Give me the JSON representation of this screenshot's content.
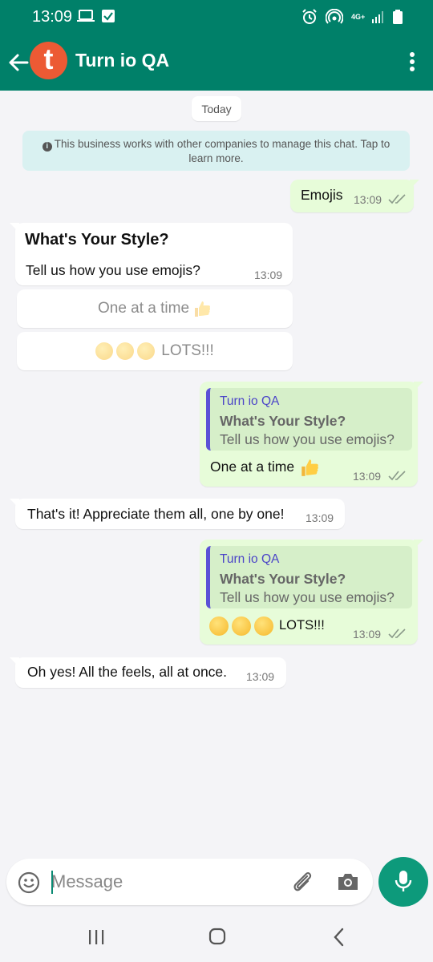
{
  "status_bar": {
    "time": "13:09",
    "network": "4G+"
  },
  "header": {
    "contact_name": "Turn io QA",
    "avatar_letter": "t",
    "avatar_color": "#ec5a34",
    "bar_color": "#008069"
  },
  "chat": {
    "day_chip": "Today",
    "notice": "This business works with other companies to manage this chat. Tap to learn more.",
    "messages": [
      {
        "direction": "out",
        "text": "Emojis",
        "time": "13:09"
      },
      {
        "direction": "in",
        "title": "What's Your Style?",
        "text": "Tell us how you use emojis?",
        "time": "13:09",
        "quick_replies": [
          "One at a time",
          "LOTS!!!"
        ]
      },
      {
        "direction": "out",
        "quote": {
          "author": "Turn io QA",
          "title": "What's Your Style?",
          "body": "Tell us how you use emojis?"
        },
        "text": "One at a time",
        "time": "13:09"
      },
      {
        "direction": "in",
        "text": "That's it! Appreciate them all, one by one!",
        "time": "13:09"
      },
      {
        "direction": "out",
        "quote": {
          "author": "Turn io QA",
          "title": "What's Your Style?",
          "body": "Tell us how you use emojis?"
        },
        "text": "LOTS!!!",
        "time": "13:09"
      },
      {
        "direction": "in",
        "text": "Oh yes! All the feels, all at once.",
        "time": "13:09"
      }
    ]
  },
  "composer": {
    "placeholder": "Message"
  },
  "colors": {
    "outgoing_bubble": "#e7fcd9",
    "incoming_bubble": "#ffffff",
    "quote_bar": "#5b52d6",
    "mic_button": "#0d9a7b"
  }
}
